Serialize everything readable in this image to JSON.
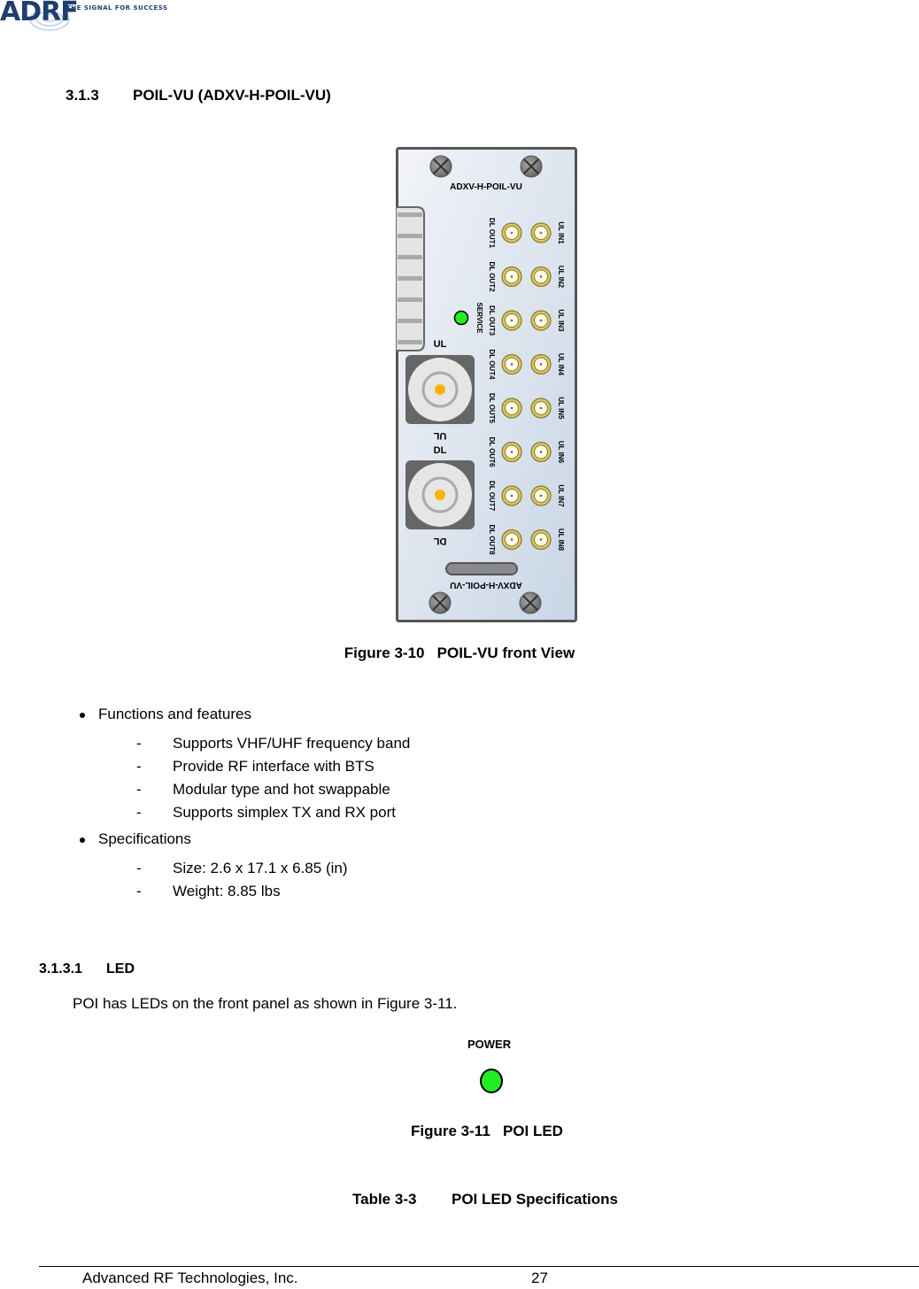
{
  "header": {
    "logo_text": "ADRF",
    "logo_tagline": "THE SIGNAL FOR SUCCESS",
    "brand_color": "#1f3f6e"
  },
  "section": {
    "number": "3.1.3",
    "title": "POIL-VU (ADXV-H-POIL-VU)"
  },
  "figure1": {
    "panel_label_top": "ADXV-H-POIL-VU",
    "panel_label_bottom": "ADXV-H-POIL-VU",
    "led_label": "SERVICE",
    "led_color": "#22ee22",
    "ul_label": "UL",
    "ul_label_flipped": "UL",
    "dl_label": "DL",
    "dl_label_flipped": "DL",
    "dl_ports": [
      "DL OUT1",
      "DL OUT2",
      "DL OUT3",
      "DL OUT4",
      "DL OUT5",
      "DL OUT6",
      "DL OUT7",
      "DL OUT8"
    ],
    "ul_ports": [
      "UL IN1",
      "UL IN2",
      "UL IN3",
      "UL IN4",
      "UL IN5",
      "UL IN6",
      "UL IN7",
      "UL IN8"
    ],
    "caption_number": "Figure 3-10",
    "caption_title": "POIL-VU front View"
  },
  "features": {
    "heading": "Functions and features",
    "items": [
      "Supports VHF/UHF frequency band",
      "Provide RF interface with BTS",
      "Modular type and hot swappable",
      "Supports simplex  TX and RX port"
    ]
  },
  "specifications": {
    "heading": "Specifications",
    "items": [
      "Size: 2.6 x 17.1 x 6.85 (in)",
      "Weight: 8.85 lbs"
    ]
  },
  "subsection": {
    "number": "3.1.3.1",
    "title": "LED",
    "paragraph": "POI has LEDs on the front panel as shown in Figure 3-11."
  },
  "figure2": {
    "led_label": "POWER",
    "led_color": "#22ee22",
    "caption_number": "Figure 3-11",
    "caption_title": "POI LED"
  },
  "table": {
    "number": "Table 3-3",
    "title": "POI LED Specifications"
  },
  "footer": {
    "company": "Advanced RF Technologies, Inc.",
    "page_number": "27"
  }
}
